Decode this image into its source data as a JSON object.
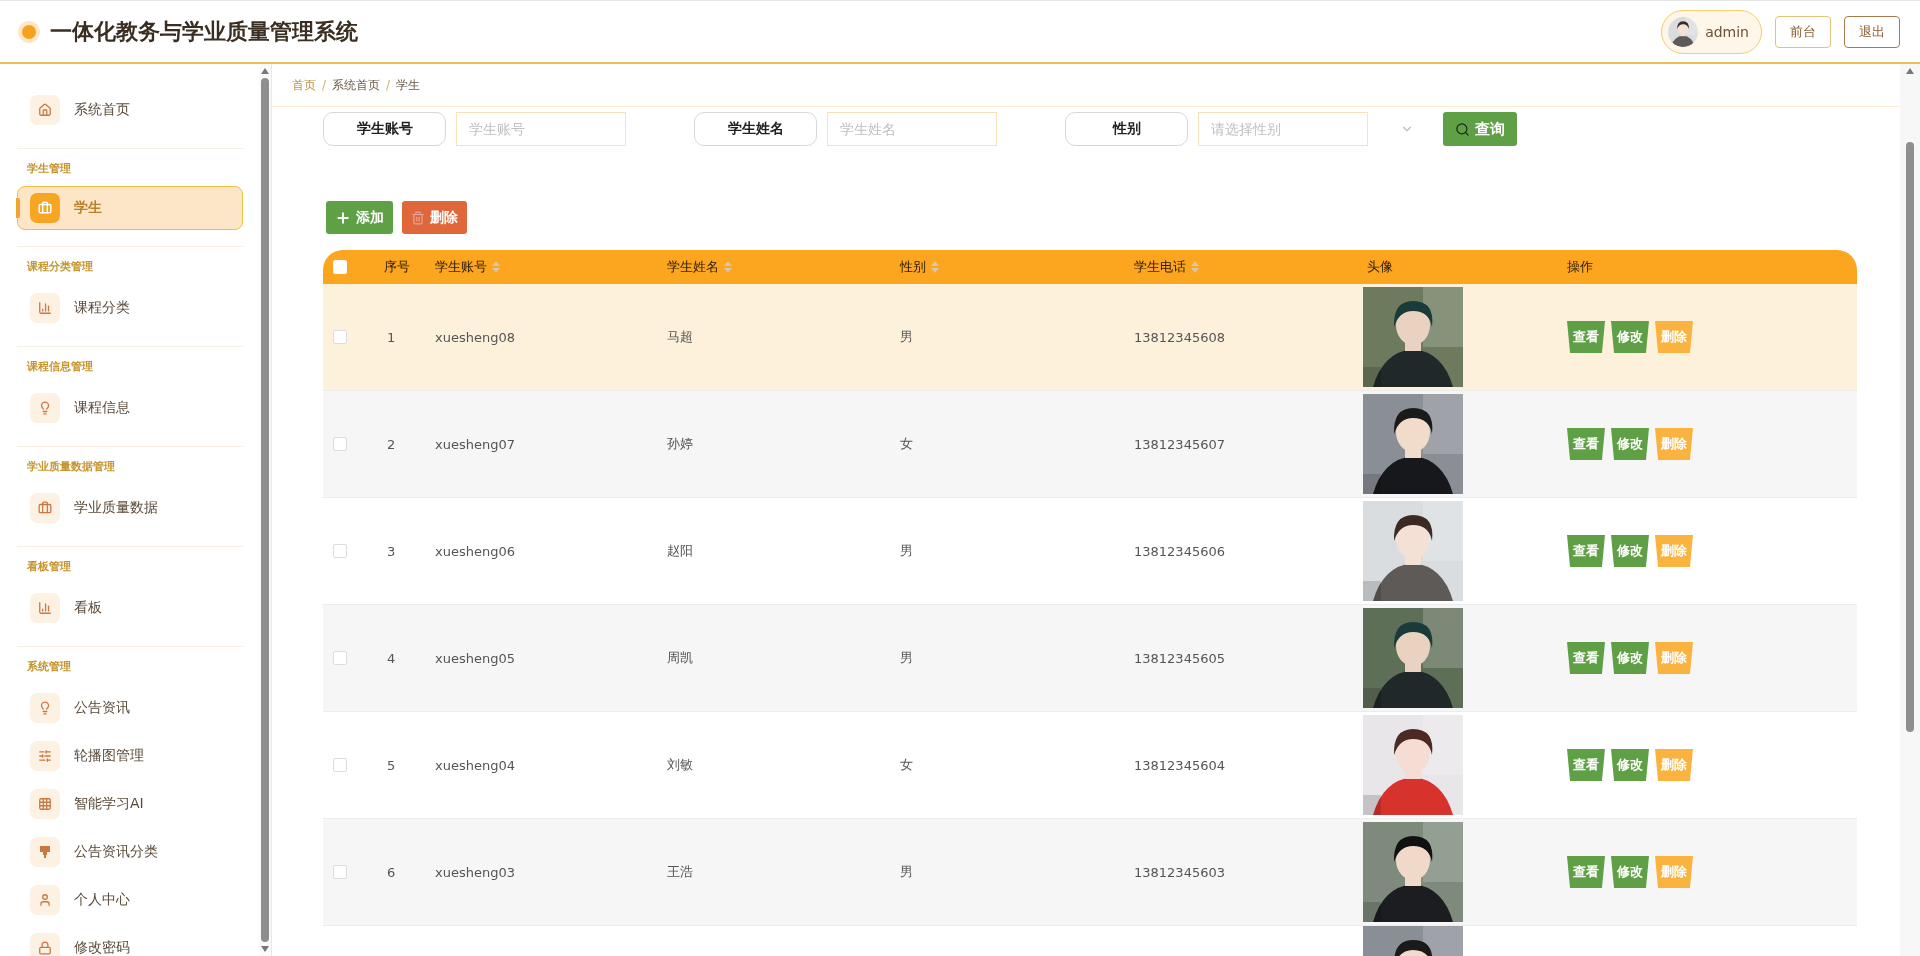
{
  "header": {
    "title": "一体化教务与学业质量管理系统",
    "user": {
      "avatar": {
        "kind": "picture"
      },
      "name": "admin"
    },
    "buttons": [
      "前台",
      "退出"
    ]
  },
  "sidebar": {
    "sections": [
      {
        "items": [
          {
            "label": "系统首页",
            "kind": "home",
            "selected": false
          }
        ]
      },
      {
        "title": "学生管理",
        "items": [
          {
            "label": "学生",
            "kind": "briefcase",
            "selected": true
          }
        ]
      },
      {
        "title": "课程分类管理",
        "items": [
          {
            "label": "课程分类",
            "kind": "bars",
            "selected": false
          }
        ]
      },
      {
        "title": "课程信息管理",
        "items": [
          {
            "label": "课程信息",
            "kind": "bulb",
            "selected": false
          }
        ]
      },
      {
        "title": "学业质量数据管理",
        "items": [
          {
            "label": "学业质量数据",
            "kind": "briefcase",
            "selected": false
          }
        ]
      },
      {
        "title": "看板管理",
        "items": [
          {
            "label": "看板",
            "kind": "bars",
            "selected": false
          }
        ]
      },
      {
        "title": "系统管理",
        "items": [
          {
            "label": "公告资讯",
            "kind": "bulb",
            "selected": false
          },
          {
            "label": "轮播图管理",
            "kind": "sliders",
            "selected": false
          },
          {
            "label": "智能学习AI",
            "kind": "grid",
            "selected": false
          },
          {
            "label": "公告资讯分类",
            "kind": "brush",
            "selected": false
          },
          {
            "label": "个人中心",
            "kind": "user",
            "selected": false
          },
          {
            "label": "修改密码",
            "kind": "lock",
            "selected": false
          }
        ]
      }
    ]
  },
  "breadcrumb": [
    {
      "label": "首页"
    },
    {
      "separator": "/",
      "label": "系统首页"
    },
    {
      "separator": "/",
      "label": "学生"
    }
  ],
  "search": {
    "fields": [
      {
        "label": "学生账号",
        "placeholder": "学生账号",
        "kind": "text"
      },
      {
        "label": "学生姓名",
        "placeholder": "学生姓名",
        "kind": "text"
      },
      {
        "label": "性别",
        "placeholder": "请选择性别",
        "kind": "select"
      }
    ],
    "button": "查询"
  },
  "actions": [
    {
      "label": "添加",
      "kind": "add"
    },
    {
      "label": "删除",
      "kind": "delete"
    }
  ],
  "table": {
    "all_checked": false,
    "columns": [
      {
        "label": "序号",
        "sortable": false
      },
      {
        "label": "学生账号",
        "sortable": true
      },
      {
        "label": "学生姓名",
        "sortable": true
      },
      {
        "label": "性别",
        "sortable": true
      },
      {
        "label": "学生电话",
        "sortable": true
      },
      {
        "label": "头像",
        "sortable": false
      },
      {
        "label": "操作",
        "sortable": false
      }
    ],
    "rows": [
      {
        "checked": false,
        "highlighted": true,
        "cells": [
          "1",
          "xuesheng08",
          "马超",
          "男",
          "13812345608"
        ],
        "avatar": {
          "kind": "picture"
        },
        "actions": [
          "查看",
          "修改",
          "删除"
        ]
      },
      {
        "checked": false,
        "highlighted": false,
        "cells": [
          "2",
          "xuesheng07",
          "孙婷",
          "女",
          "13812345607"
        ],
        "avatar": {
          "kind": "picture"
        },
        "actions": [
          "查看",
          "修改",
          "删除"
        ]
      },
      {
        "checked": false,
        "highlighted": false,
        "cells": [
          "3",
          "xuesheng06",
          "赵阳",
          "男",
          "13812345606"
        ],
        "avatar": {
          "kind": "picture"
        },
        "actions": [
          "查看",
          "修改",
          "删除"
        ]
      },
      {
        "checked": false,
        "highlighted": false,
        "cells": [
          "4",
          "xuesheng05",
          "周凯",
          "男",
          "13812345605"
        ],
        "avatar": {
          "kind": "picture"
        },
        "actions": [
          "查看",
          "修改",
          "删除"
        ]
      },
      {
        "checked": false,
        "highlighted": false,
        "cells": [
          "5",
          "xuesheng04",
          "刘敏",
          "女",
          "13812345604"
        ],
        "avatar": {
          "kind": "picture"
        },
        "actions": [
          "查看",
          "修改",
          "删除"
        ]
      },
      {
        "checked": false,
        "highlighted": false,
        "cells": [
          "6",
          "xuesheng03",
          "王浩",
          "男",
          "13812345603"
        ],
        "avatar": {
          "kind": "picture"
        },
        "actions": [
          "查看",
          "修改",
          "删除"
        ]
      }
    ],
    "partial_row": {
      "avatar": {
        "kind": "picture"
      }
    }
  }
}
